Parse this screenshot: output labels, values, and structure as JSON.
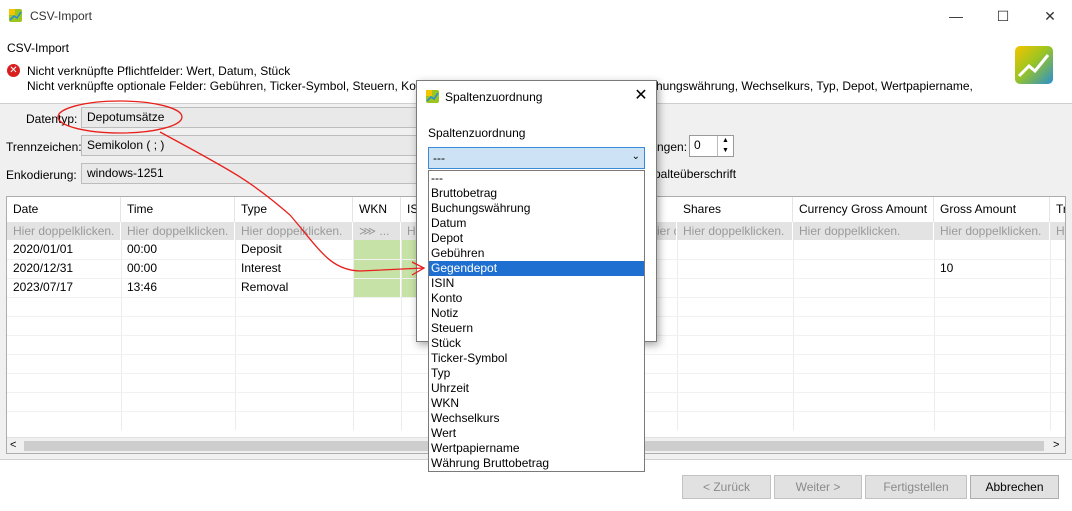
{
  "window": {
    "title": "CSV-Import",
    "minimize": "—",
    "maximize": "☐",
    "close": "✕"
  },
  "wizard": {
    "title": "CSV-Import",
    "error_line1": "Nicht verknüpfte Pflichtfelder: Wert, Datum, Stück",
    "error_line2_left": "Nicht verknüpfte optionale Felder: Gebühren, Ticker-Symbol, Steuern, Konto",
    "error_line2_right": "hungswährung, Wechselkurs, Typ, Depot, Wertpapiername,"
  },
  "form": {
    "datentyp_label": "Datentyp:",
    "datentyp_value": "Depotumsätze",
    "trennzeichen_label": "Trennzeichen:",
    "trennzeichen_value": "Semikolon ( ; )",
    "enkodierung_label": "Enkodierung:",
    "enkodierung_value": "windows-1251",
    "skip_label": "ngen:",
    "skip_value": "0",
    "header_label": "palteüberschrift"
  },
  "table": {
    "columns": [
      "Date",
      "Time",
      "Type",
      "WKN",
      "IS",
      "Shares",
      "Currency Gross Amount",
      "Gross Amount",
      "Tr"
    ],
    "hint": "Hier doppelklicken.",
    "hint_short": "ier doppelklicken.",
    "hint_wkn": "⋙ ...",
    "hint_last": "H",
    "rows": [
      {
        "date": "2020/01/01",
        "time": "00:00",
        "type": "Deposit",
        "gross": ""
      },
      {
        "date": "2020/12/31",
        "time": "00:00",
        "type": "Interest",
        "gross": "10"
      },
      {
        "date": "2023/07/17",
        "time": "13:46",
        "type": "Removal",
        "gross": ""
      }
    ],
    "scroll_left": "<",
    "scroll_right": ">"
  },
  "buttons": {
    "back": "< Zurück",
    "next": "Weiter >",
    "finish": "Fertigstellen",
    "cancel": "Abbrechen"
  },
  "dialog": {
    "title": "Spaltenzuordnung",
    "label": "Spaltenzuordnung",
    "selected_value": "---",
    "options": [
      "---",
      "Bruttobetrag",
      "Buchungswährung",
      "Datum",
      "Depot",
      "Gebühren",
      "Gegendepot",
      "ISIN",
      "Konto",
      "Notiz",
      "Steuern",
      "Stück",
      "Ticker-Symbol",
      "Typ",
      "Uhrzeit",
      "WKN",
      "Wechselkurs",
      "Wert",
      "Wertpapiername",
      "Währung Bruttobetrag"
    ],
    "highlighted_index": 6
  },
  "colors": {
    "annotation": "#e8201c",
    "selection": "#1e6fd0",
    "error": "#d81e1e"
  }
}
